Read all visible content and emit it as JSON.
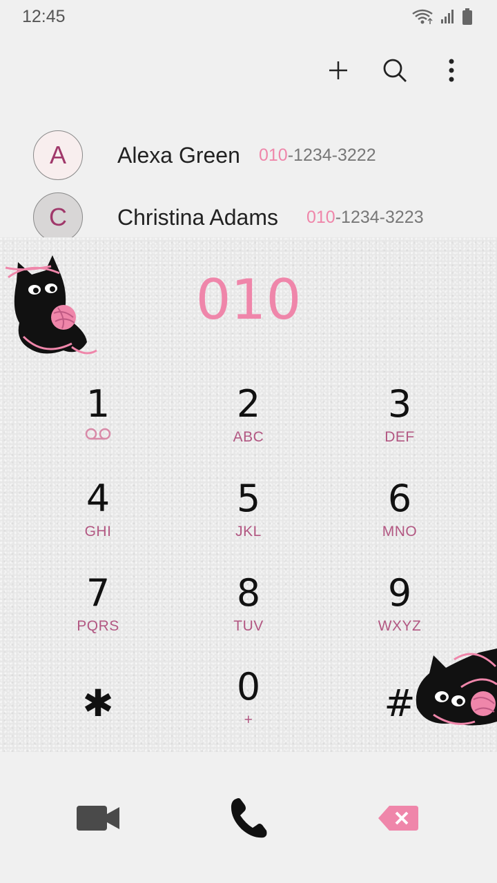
{
  "status_bar": {
    "time": "12:45"
  },
  "contacts": [
    {
      "initial": "A",
      "name": "Alexa Green",
      "number_match": "010",
      "number_rest": "-1234-3222",
      "avatar_bg": "#f8eeee"
    },
    {
      "initial": "C",
      "name": "Christina Adams",
      "number_match": "010",
      "number_rest": "-1234-3223",
      "avatar_bg": "#d8d6d6"
    }
  ],
  "dialer": {
    "entered_number": "010"
  },
  "keypad": [
    {
      "digit": "1",
      "letters": "",
      "icon": "voicemail-icon"
    },
    {
      "digit": "2",
      "letters": "ABC"
    },
    {
      "digit": "3",
      "letters": "DEF"
    },
    {
      "digit": "4",
      "letters": "GHI"
    },
    {
      "digit": "5",
      "letters": "JKL"
    },
    {
      "digit": "6",
      "letters": "MNO"
    },
    {
      "digit": "7",
      "letters": "PQRS"
    },
    {
      "digit": "8",
      "letters": "TUV"
    },
    {
      "digit": "9",
      "letters": "WXYZ"
    },
    {
      "digit": "✱",
      "letters": ""
    },
    {
      "digit": "0",
      "letters": "+"
    },
    {
      "digit": "#",
      "letters": ""
    }
  ],
  "colors": {
    "accent": "#ef86aa",
    "letters": "#b25782",
    "digit": "#111111"
  }
}
